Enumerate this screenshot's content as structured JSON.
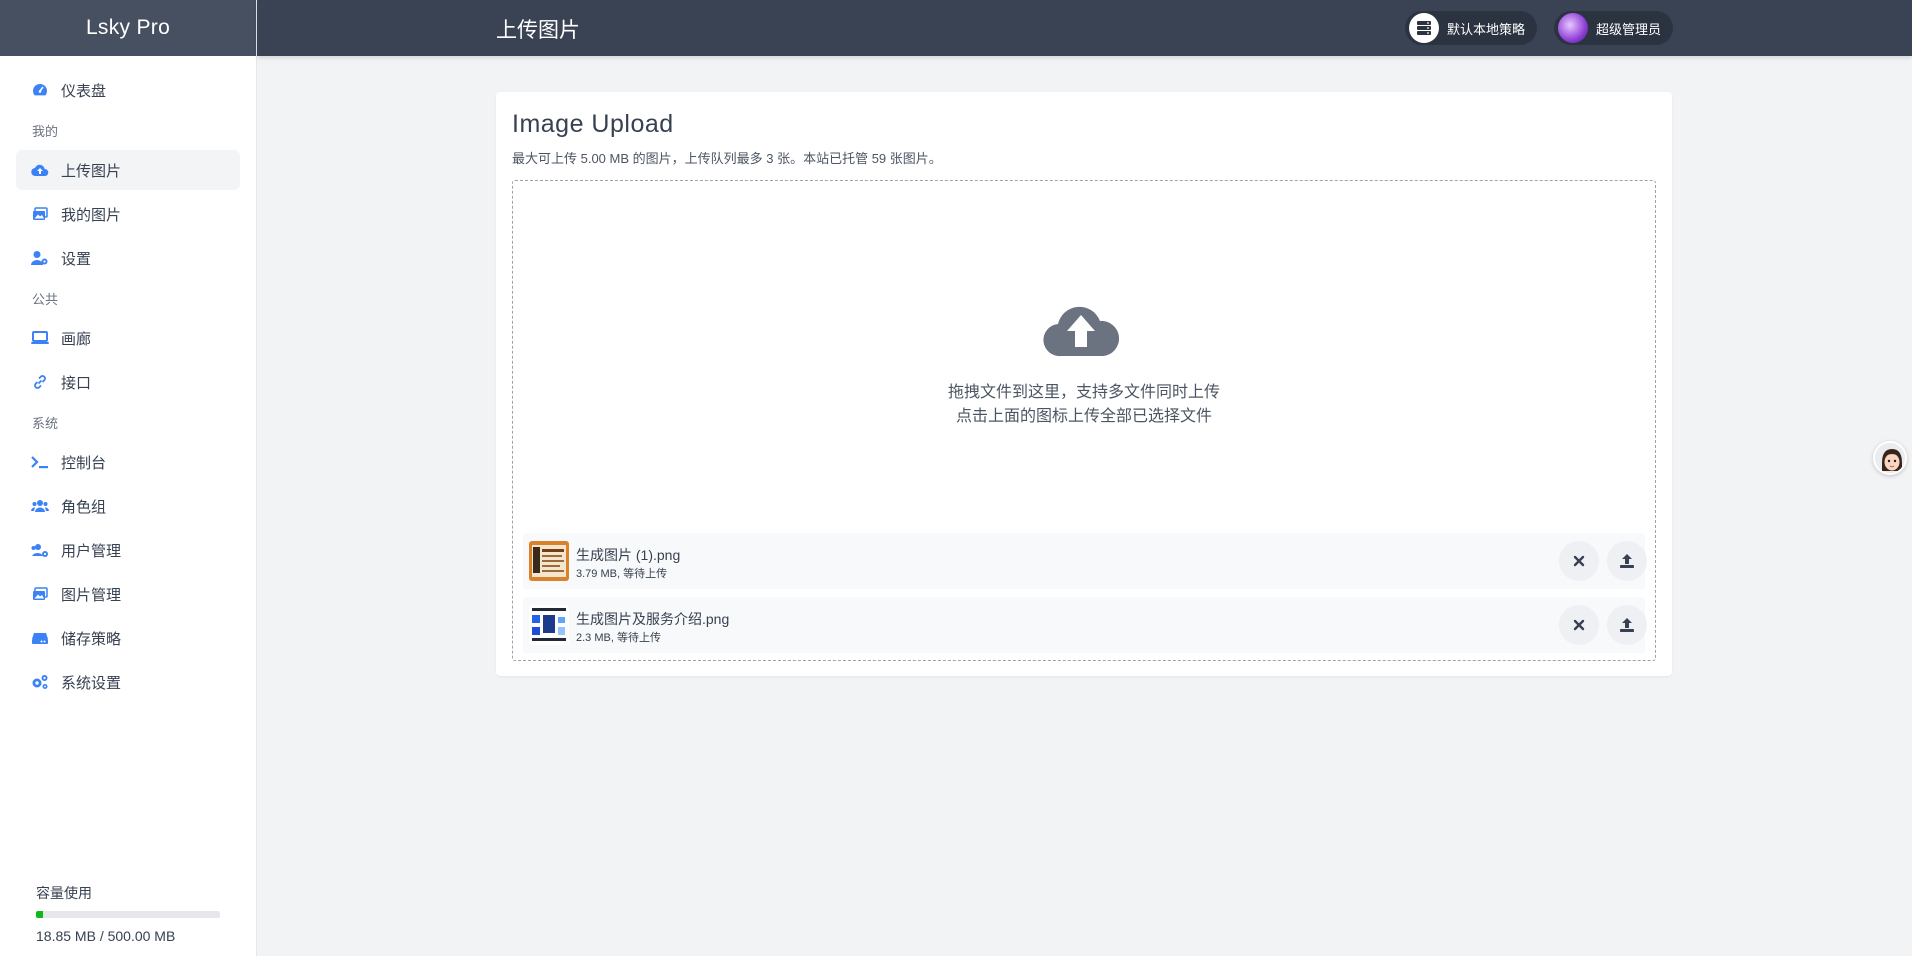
{
  "app": {
    "brand": "Lsky Pro",
    "page_title": "上传图片"
  },
  "sidebar": {
    "items": [
      {
        "label": "仪表盘",
        "icon": "gauge-icon"
      },
      {
        "section": "我的"
      },
      {
        "label": "上传图片",
        "icon": "cloud-upload-icon",
        "active": true
      },
      {
        "label": "我的图片",
        "icon": "images-icon"
      },
      {
        "label": "设置",
        "icon": "user-cog-icon"
      },
      {
        "section": "公共"
      },
      {
        "label": "画廊",
        "icon": "laptop-icon"
      },
      {
        "label": "接口",
        "icon": "link-icon"
      },
      {
        "section": "系统"
      },
      {
        "label": "控制台",
        "icon": "terminal-icon"
      },
      {
        "label": "角色组",
        "icon": "users-icon"
      },
      {
        "label": "用户管理",
        "icon": "users-cog-icon"
      },
      {
        "label": "图片管理",
        "icon": "images-icon"
      },
      {
        "label": "储存策略",
        "icon": "hdd-icon"
      },
      {
        "label": "系统设置",
        "icon": "cogs-icon"
      }
    ],
    "storage": {
      "label": "容量使用",
      "value": "18.85 MB / 500.00 MB",
      "used_fraction": 0.0377
    }
  },
  "topbar": {
    "strategy_label": "默认本地策略",
    "user_label": "超级管理员"
  },
  "upload": {
    "title": "Image Upload",
    "description": "最大可上传 5.00 MB 的图片，上传队列最多 3 张。本站已托管 59 张图片。",
    "hint_line1": "拖拽文件到这里，支持多文件同时上传",
    "hint_line2": "点击上面的图标上传全部已选择文件",
    "files": [
      {
        "name": "生成图片 (1).png",
        "meta": "3.79 MB, 等待上传"
      },
      {
        "name": "生成图片及服务介绍.png",
        "meta": "2.3 MB, 等待上传"
      }
    ]
  },
  "colors": {
    "topbar": "#394354",
    "brand_bg": "#465061",
    "storage_fill": "#10b81e",
    "accent_icon": "#3b82f6"
  }
}
